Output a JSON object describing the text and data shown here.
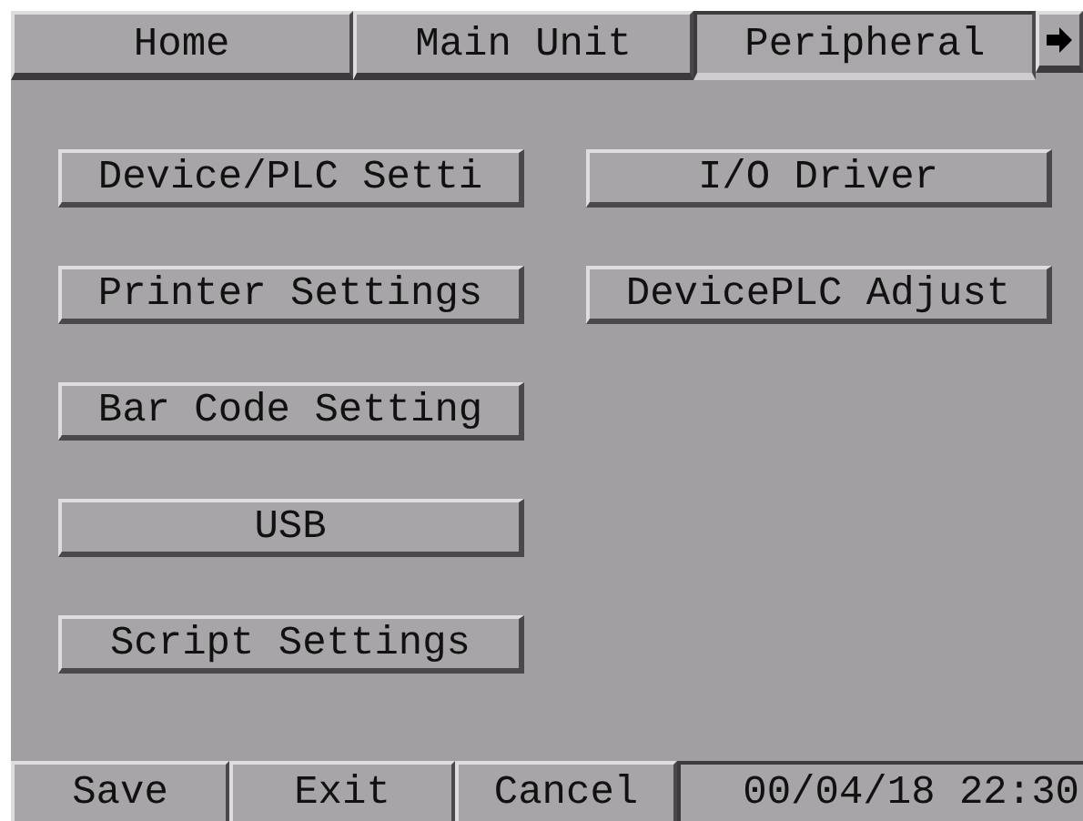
{
  "tabs": [
    {
      "label": "Home",
      "selected": false
    },
    {
      "label": "Main Unit",
      "selected": false
    },
    {
      "label": "Peripheral",
      "selected": true
    }
  ],
  "menu_columns": [
    [
      "Device/PLC Setti",
      "Printer Settings",
      "Bar Code Setting",
      "USB",
      "Script Settings"
    ],
    [
      "I/O Driver",
      "DevicePLC Adjust"
    ]
  ],
  "footer": {
    "buttons": [
      "Save",
      "Exit",
      "Cancel"
    ],
    "datetime": "00/04/18 22:30"
  }
}
